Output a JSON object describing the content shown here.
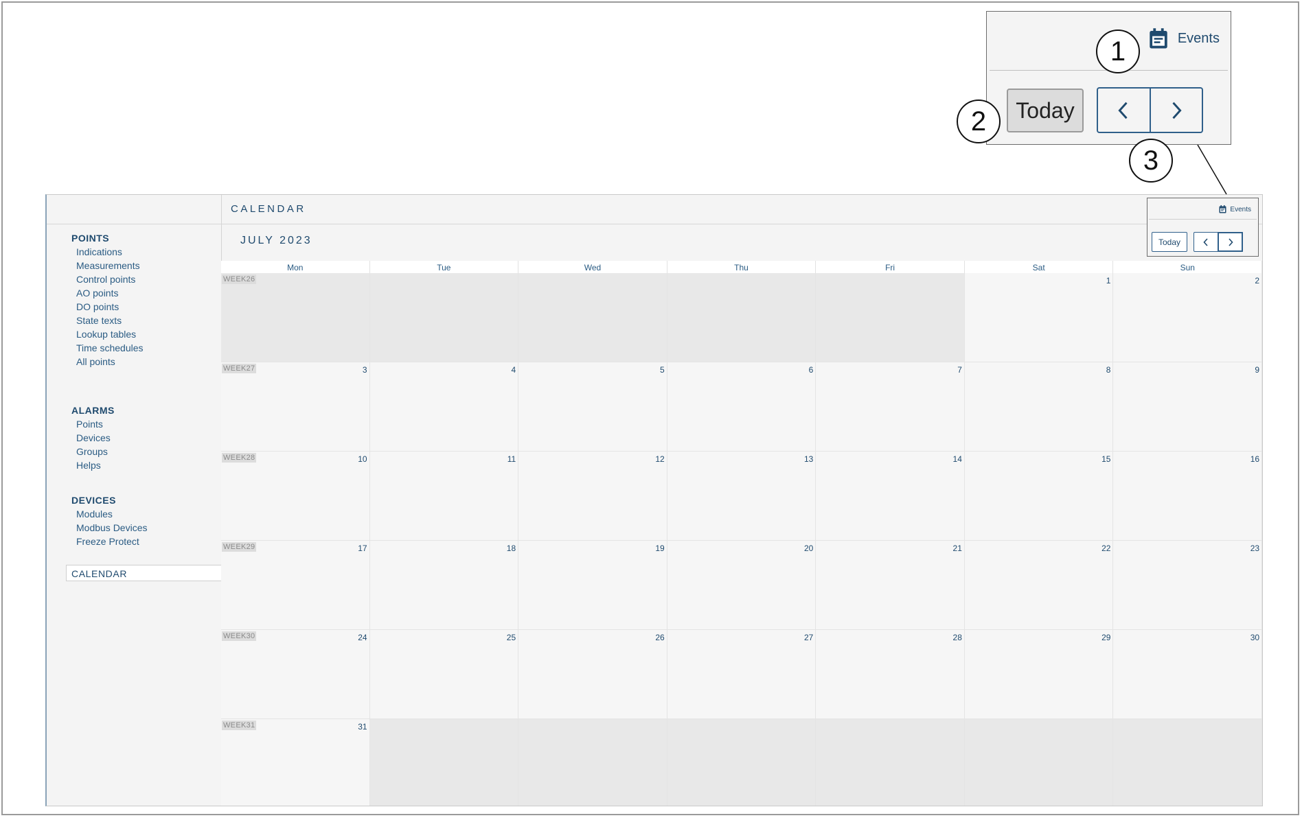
{
  "sidebar": {
    "sections": [
      {
        "title": "POINTS",
        "items": [
          "Indications",
          "Measurements",
          "Control points",
          "AO points",
          "DO points",
          "State texts",
          "Lookup tables",
          "Time schedules",
          "All points"
        ]
      },
      {
        "title": "ALARMS",
        "items": [
          "Points",
          "Devices",
          "Groups",
          "Helps"
        ]
      },
      {
        "title": "DEVICES",
        "items": [
          "Modules",
          "Modbus Devices",
          "Freeze Protect"
        ]
      }
    ],
    "active_item": "CALENDAR"
  },
  "main": {
    "title": "CALENDAR",
    "month": "JULY 2023",
    "toolbar": {
      "events_label": "Events",
      "today_label": "Today"
    },
    "day_headers": [
      "Mon",
      "Tue",
      "Wed",
      "Thu",
      "Fri",
      "Sat",
      "Sun"
    ],
    "weeks": [
      {
        "label": "WEEK26",
        "days": [
          "",
          "",
          "",
          "",
          "",
          "1",
          "2"
        ]
      },
      {
        "label": "WEEK27",
        "days": [
          "3",
          "4",
          "5",
          "6",
          "7",
          "8",
          "9"
        ]
      },
      {
        "label": "WEEK28",
        "days": [
          "10",
          "11",
          "12",
          "13",
          "14",
          "15",
          "16"
        ]
      },
      {
        "label": "WEEK29",
        "days": [
          "17",
          "18",
          "19",
          "20",
          "21",
          "22",
          "23"
        ]
      },
      {
        "label": "WEEK30",
        "days": [
          "24",
          "25",
          "26",
          "27",
          "28",
          "29",
          "30"
        ]
      },
      {
        "label": "WEEK31",
        "days": [
          "31",
          "",
          "",
          "",
          "",
          "",
          ""
        ]
      }
    ]
  },
  "callout": {
    "events_label": "Events",
    "today_label": "Today",
    "markers": [
      "1",
      "2",
      "3"
    ]
  },
  "colors": {
    "accent": "#1f4a6e",
    "out_of_month": "#e8e8e8"
  }
}
